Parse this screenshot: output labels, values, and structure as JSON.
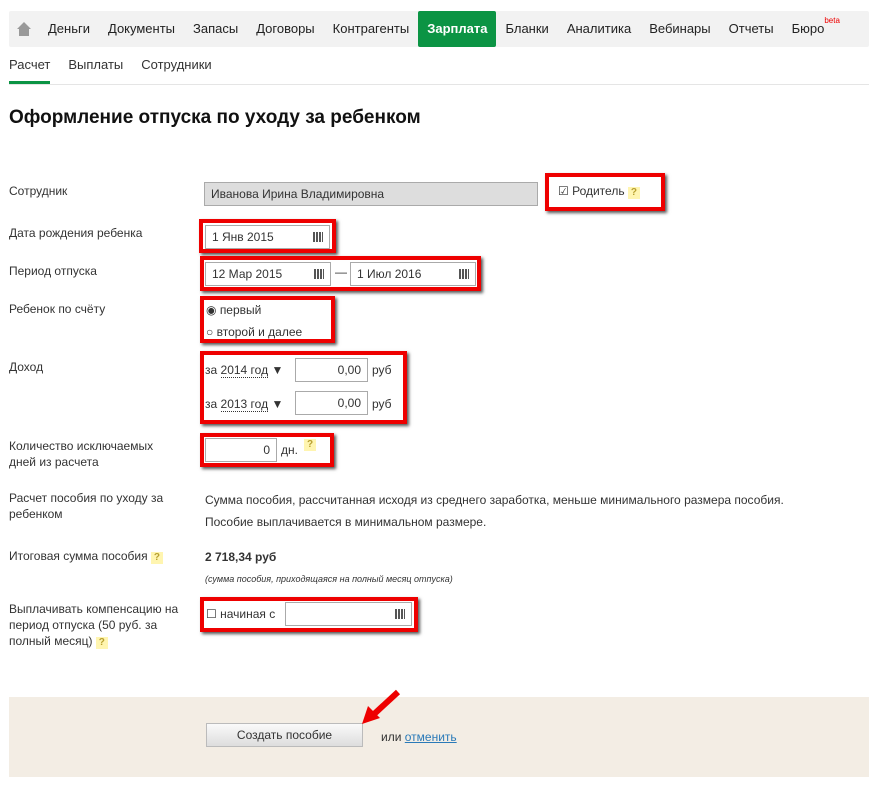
{
  "nav": {
    "items": [
      "Деньги",
      "Документы",
      "Запасы",
      "Договоры",
      "Контрагенты",
      "Зарплата",
      "Бланки",
      "Аналитика",
      "Вебинары",
      "Отчеты",
      "Бюро"
    ],
    "active": "Зарплата",
    "beta": "beta"
  },
  "subnav": {
    "items": [
      "Расчет",
      "Выплаты",
      "Сотрудники"
    ],
    "active": "Расчет"
  },
  "title": "Оформление отпуска по уходу за ребенком",
  "form": {
    "employee_label": "Сотрудник",
    "employee_value": "Иванова Ирина Владимировна",
    "parent_label": "Родитель",
    "parent_checked": true,
    "birth_label": "Дата рождения ребенка",
    "birth_value": "1 Янв 2015",
    "period_label": "Период отпуска",
    "period_from": "12 Мар 2015",
    "period_dash": "—",
    "period_to": "1 Июл 2016",
    "child_label": "Ребенок по счёту",
    "child_options": [
      "первый",
      "второй и далее"
    ],
    "child_selected": "первый",
    "income_label": "Доход",
    "income_rows": [
      {
        "prefix": "за",
        "year": "2014 год",
        "value": "0,00",
        "unit": "руб"
      },
      {
        "prefix": "за",
        "year": "2013 год",
        "value": "0,00",
        "unit": "руб"
      }
    ],
    "excluded_label": "Количество исключаемых дней из расчета",
    "excluded_value": "0",
    "excluded_unit": "дн.",
    "calc_label": "Расчет пособия по уходу за ребенком",
    "calc_text1": "Сумма пособия, рассчитанная исходя из среднего заработка, меньше минимального размера пособия.",
    "calc_text2": "Пособие выплачивается в минимальном размере.",
    "total_label": "Итоговая сумма пособия",
    "total_value": "2 718,34 руб",
    "total_note": "(сумма пособия, приходящаяся на полный месяц отпуска)",
    "comp_label": "Выплачивать компенсацию на период отпуска (50 руб. за полный месяц)",
    "comp_from_label": "начиная с",
    "comp_value": ""
  },
  "footer": {
    "create": "Создать пособие",
    "or": "или",
    "cancel": "отменить"
  },
  "help": "?"
}
